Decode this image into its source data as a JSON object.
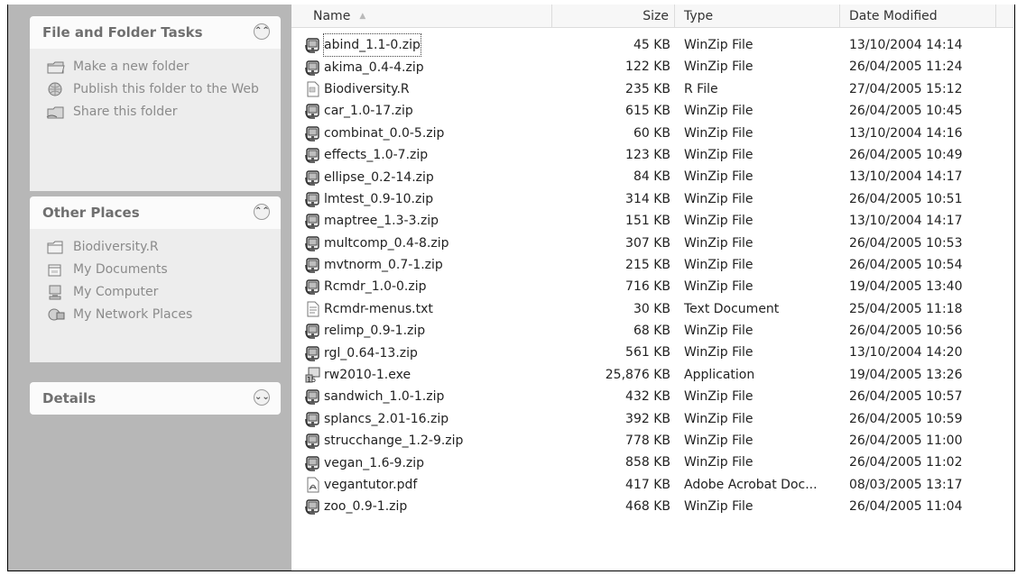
{
  "task_pane": {
    "file_folder_tasks": {
      "title": "File and Folder Tasks",
      "items": [
        {
          "label": "Make a new folder",
          "icon": "new-folder-icon"
        },
        {
          "label": "Publish this folder to the Web",
          "icon": "globe-icon"
        },
        {
          "label": "Share this folder",
          "icon": "share-folder-icon"
        }
      ]
    },
    "other_places": {
      "title": "Other Places",
      "items": [
        {
          "label": "Biodiversity.R",
          "icon": "folder-icon"
        },
        {
          "label": "My Documents",
          "icon": "documents-icon"
        },
        {
          "label": "My Computer",
          "icon": "computer-icon"
        },
        {
          "label": "My Network Places",
          "icon": "network-icon"
        }
      ]
    },
    "details": {
      "title": "Details"
    }
  },
  "columns": {
    "name": "Name",
    "size": "Size",
    "type": "Type",
    "date": "Date Modified"
  },
  "files": [
    {
      "name": "abind_1.1-0.zip",
      "size": "45 KB",
      "type": "WinZip File",
      "date": "13/10/2004 14:14",
      "icon": "winzip-icon"
    },
    {
      "name": "akima_0.4-4.zip",
      "size": "122 KB",
      "type": "WinZip File",
      "date": "26/04/2005 11:24",
      "icon": "winzip-icon"
    },
    {
      "name": "Biodiversity.R",
      "size": "235 KB",
      "type": "R File",
      "date": "27/04/2005 15:12",
      "icon": "r-file-icon"
    },
    {
      "name": "car_1.0-17.zip",
      "size": "615 KB",
      "type": "WinZip File",
      "date": "26/04/2005 10:45",
      "icon": "winzip-icon"
    },
    {
      "name": "combinat_0.0-5.zip",
      "size": "60 KB",
      "type": "WinZip File",
      "date": "13/10/2004 14:16",
      "icon": "winzip-icon"
    },
    {
      "name": "effects_1.0-7.zip",
      "size": "123 KB",
      "type": "WinZip File",
      "date": "26/04/2005 10:49",
      "icon": "winzip-icon"
    },
    {
      "name": "ellipse_0.2-14.zip",
      "size": "84 KB",
      "type": "WinZip File",
      "date": "13/10/2004 14:17",
      "icon": "winzip-icon"
    },
    {
      "name": "lmtest_0.9-10.zip",
      "size": "314 KB",
      "type": "WinZip File",
      "date": "26/04/2005 10:51",
      "icon": "winzip-icon"
    },
    {
      "name": "maptree_1.3-3.zip",
      "size": "151 KB",
      "type": "WinZip File",
      "date": "13/10/2004 14:17",
      "icon": "winzip-icon"
    },
    {
      "name": "multcomp_0.4-8.zip",
      "size": "307 KB",
      "type": "WinZip File",
      "date": "26/04/2005 10:53",
      "icon": "winzip-icon"
    },
    {
      "name": "mvtnorm_0.7-1.zip",
      "size": "215 KB",
      "type": "WinZip File",
      "date": "26/04/2005 10:54",
      "icon": "winzip-icon"
    },
    {
      "name": "Rcmdr_1.0-0.zip",
      "size": "716 KB",
      "type": "WinZip File",
      "date": "19/04/2005 13:40",
      "icon": "winzip-icon"
    },
    {
      "name": "Rcmdr-menus.txt",
      "size": "30 KB",
      "type": "Text Document",
      "date": "25/04/2005 11:18",
      "icon": "text-file-icon"
    },
    {
      "name": "relimp_0.9-1.zip",
      "size": "68 KB",
      "type": "WinZip File",
      "date": "26/04/2005 10:56",
      "icon": "winzip-icon"
    },
    {
      "name": "rgl_0.64-13.zip",
      "size": "561 KB",
      "type": "WinZip File",
      "date": "13/10/2004 14:20",
      "icon": "winzip-icon"
    },
    {
      "name": "rw2010-1.exe",
      "size": "25,876 KB",
      "type": "Application",
      "date": "19/04/2005 13:26",
      "icon": "installer-icon"
    },
    {
      "name": "sandwich_1.0-1.zip",
      "size": "432 KB",
      "type": "WinZip File",
      "date": "26/04/2005 10:57",
      "icon": "winzip-icon"
    },
    {
      "name": "splancs_2.01-16.zip",
      "size": "392 KB",
      "type": "WinZip File",
      "date": "26/04/2005 10:59",
      "icon": "winzip-icon"
    },
    {
      "name": "strucchange_1.2-9.zip",
      "size": "778 KB",
      "type": "WinZip File",
      "date": "26/04/2005 11:00",
      "icon": "winzip-icon"
    },
    {
      "name": "vegan_1.6-9.zip",
      "size": "858 KB",
      "type": "WinZip File",
      "date": "26/04/2005 11:02",
      "icon": "winzip-icon"
    },
    {
      "name": "vegantutor.pdf",
      "size": "417 KB",
      "type": "Adobe Acrobat Doc...",
      "date": "08/03/2005 13:17",
      "icon": "pdf-icon"
    },
    {
      "name": "zoo_0.9-1.zip",
      "size": "468 KB",
      "type": "WinZip File",
      "date": "26/04/2005 11:04",
      "icon": "winzip-icon"
    }
  ]
}
